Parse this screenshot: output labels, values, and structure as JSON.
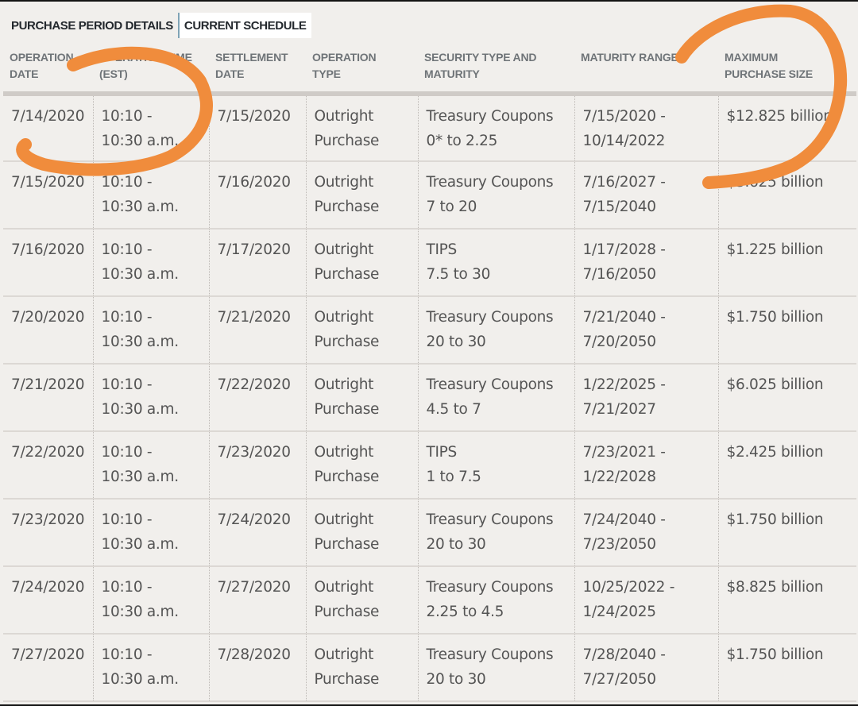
{
  "tabs": [
    {
      "label": "PURCHASE PERIOD DETAILS",
      "active": false
    },
    {
      "label": "CURRENT SCHEDULE",
      "active": true
    }
  ],
  "table": {
    "headers": [
      "OPERATION\nDATE",
      "OPERATION TIME\n(EST)",
      "SETTLEMENT\nDATE",
      "OPERATION\nTYPE",
      "SECURITY TYPE AND\nMATURITY",
      "MATURITY RANGE",
      "MAXIMUM\nPURCHASE SIZE"
    ],
    "rows": [
      [
        "7/14/2020",
        "10:10 -\n10:30 a.m.",
        "7/15/2020",
        "Outright\nPurchase",
        "Treasury Coupons\n0* to 2.25",
        "7/15/2020 -\n10/14/2022",
        "$12.825 billion"
      ],
      [
        "7/15/2020",
        "10:10 -\n10:30 a.m.",
        "7/16/2020",
        "Outright\nPurchase",
        "Treasury Coupons\n7 to 20",
        "7/16/2027 -\n7/15/2040",
        "$3.625 billion"
      ],
      [
        "7/16/2020",
        "10:10 -\n10:30 a.m.",
        "7/17/2020",
        "Outright\nPurchase",
        "TIPS\n7.5 to 30",
        "1/17/2028 -\n7/16/2050",
        "$1.225 billion"
      ],
      [
        "7/20/2020",
        "10:10 -\n10:30 a.m.",
        "7/21/2020",
        "Outright\nPurchase",
        "Treasury Coupons\n20 to 30",
        "7/21/2040 -\n7/20/2050",
        "$1.750 billion"
      ],
      [
        "7/21/2020",
        "10:10 -\n10:30 a.m.",
        "7/22/2020",
        "Outright\nPurchase",
        "Treasury Coupons\n4.5 to 7",
        "1/22/2025 -\n7/21/2027",
        "$6.025 billion"
      ],
      [
        "7/22/2020",
        "10:10 -\n10:30 a.m.",
        "7/23/2020",
        "Outright\nPurchase",
        "TIPS\n1 to 7.5",
        "7/23/2021 -\n1/22/2028",
        "$2.425 billion"
      ],
      [
        "7/23/2020",
        "10:10 -\n10:30 a.m.",
        "7/24/2020",
        "Outright\nPurchase",
        "Treasury Coupons\n20 to 30",
        "7/24/2040 -\n7/23/2050",
        "$1.750 billion"
      ],
      [
        "7/24/2020",
        "10:10 -\n10:30 a.m.",
        "7/27/2020",
        "Outright\nPurchase",
        "Treasury Coupons\n2.25 to 4.5",
        "10/25/2022 -\n1/24/2025",
        "$8.825 billion"
      ],
      [
        "7/27/2020",
        "10:10 -\n10:30 a.m.",
        "7/28/2020",
        "Outright\nPurchase",
        "Treasury Coupons\n20 to 30",
        "7/28/2040 -\n7/27/2050",
        "$1.750 billion"
      ]
    ]
  },
  "annotations": {
    "color": "#f08c3c",
    "shapes": [
      "left-hook-curve",
      "right-hook-curve"
    ]
  }
}
